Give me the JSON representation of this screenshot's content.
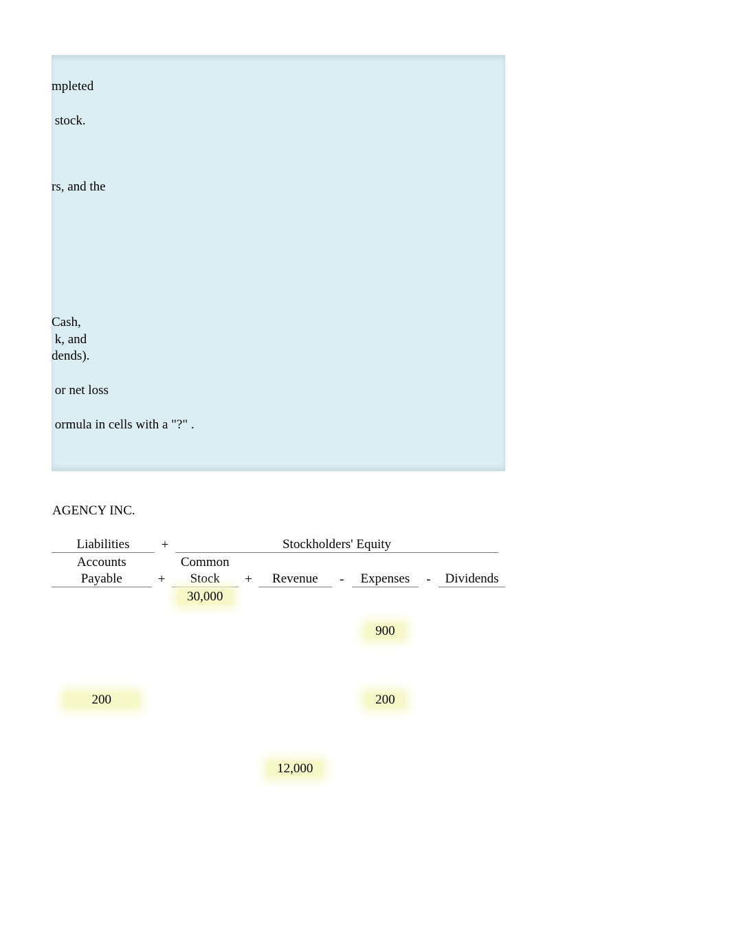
{
  "instructions": {
    "line1": "mpleted",
    "line2": " stock.",
    "line3": "rs, and the",
    "line4": "Cash,",
    "line5": " k, and",
    "line6": "dends).",
    "line7": " or net loss",
    "line8": " ormula in cells with a \"?\" ."
  },
  "title": "AGENCY INC.",
  "headers": {
    "liabilities": "Liabilities",
    "stockholders_equity": "Stockholders' Equity",
    "accounts_payable_l1": "Accounts",
    "accounts_payable_l2": "Payable",
    "common_stock_l1": "Common",
    "common_stock_l2": "Stock",
    "revenue": "Revenue",
    "expenses": "Expenses",
    "dividends": "Dividends",
    "plus": "+",
    "minus": "-"
  },
  "values": {
    "common_stock": "30,000",
    "expenses_1": "900",
    "accounts_payable": "200",
    "expenses_2": "200",
    "revenue": "12,000"
  }
}
